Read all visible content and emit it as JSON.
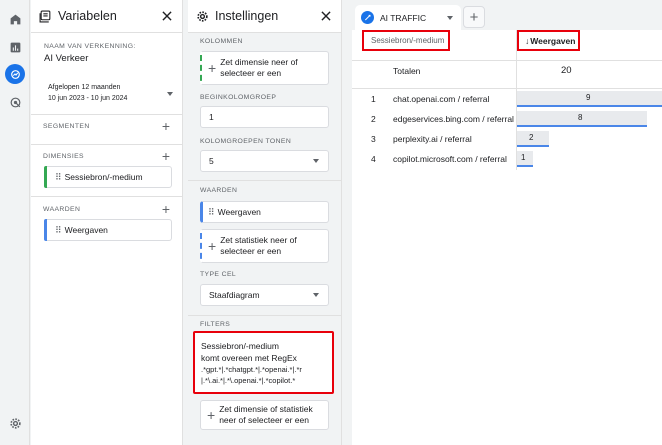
{
  "rail": {
    "icons": [
      "home-icon",
      "reports-icon",
      "explore-icon",
      "advertising-icon",
      "settings-icon"
    ]
  },
  "variables_panel": {
    "title": "Variabelen",
    "exploration_name_label": "NAAM VAN VERKENNING:",
    "exploration_name": "AI Verkeer",
    "date_range_label": "Afgelopen 12 maanden",
    "date_range_value": "10 jun 2023 - 10 jun 2024",
    "segments_label": "SEGMENTEN",
    "dimensions_label": "DIMENSIES",
    "dimensions": [
      "Sessiebron/-medium"
    ],
    "values_label": "WAARDEN",
    "values": [
      "Weergaven"
    ]
  },
  "settings_panel": {
    "title": "Instellingen",
    "columns_label": "KOLOMMEN",
    "columns_placeholder": "Zet dimensie neer of selecteer er een",
    "start_column_group_label": "BEGINKOLOMGROEP",
    "start_column_group_value": "1",
    "show_column_groups_label": "KOLOMGROEPEN TONEN",
    "show_column_groups_value": "5",
    "values_label": "WAARDEN",
    "values_item": "Weergaven",
    "values_placeholder": "Zet statistiek neer of selecteer er een",
    "cell_type_label": "TYPE CEL",
    "cell_type_value": "Staafdiagram",
    "filters_label": "FILTERS",
    "filter_dimension": "Sessiebron/-medium",
    "filter_condition": "komt overeen met RegEx",
    "filter_regex_line1": ".*gpt.*|.*chatgpt.*|.*openai.*|.*r",
    "filter_regex_line2": "|.*\\.ai.*|.*\\.openai.*|.*copilot.*",
    "filters_placeholder": "Zet dimensie of statistiek neer of selecteer er een"
  },
  "report": {
    "tab_label": "AI TRAFFIC",
    "dimension_header": "Sessiebron/-medium",
    "metric_header": "Weergaven",
    "sort_arrow": "↓",
    "totals_label": "Totalen",
    "totals_value": "20",
    "rows": [
      {
        "index": "1",
        "source": "chat.openai.com / referral",
        "value": "9"
      },
      {
        "index": "2",
        "source": "edgeservices.bing.com / referral",
        "value": "8"
      },
      {
        "index": "3",
        "source": "perplexity.ai / referral",
        "value": "2"
      },
      {
        "index": "4",
        "source": "copilot.microsoft.com / referral",
        "value": "1"
      }
    ]
  },
  "colors": {
    "accent": "#1a73e8",
    "highlight": "#e8000b",
    "dimension_bar": "#34a853",
    "metric_bar": "#4a86e8"
  }
}
